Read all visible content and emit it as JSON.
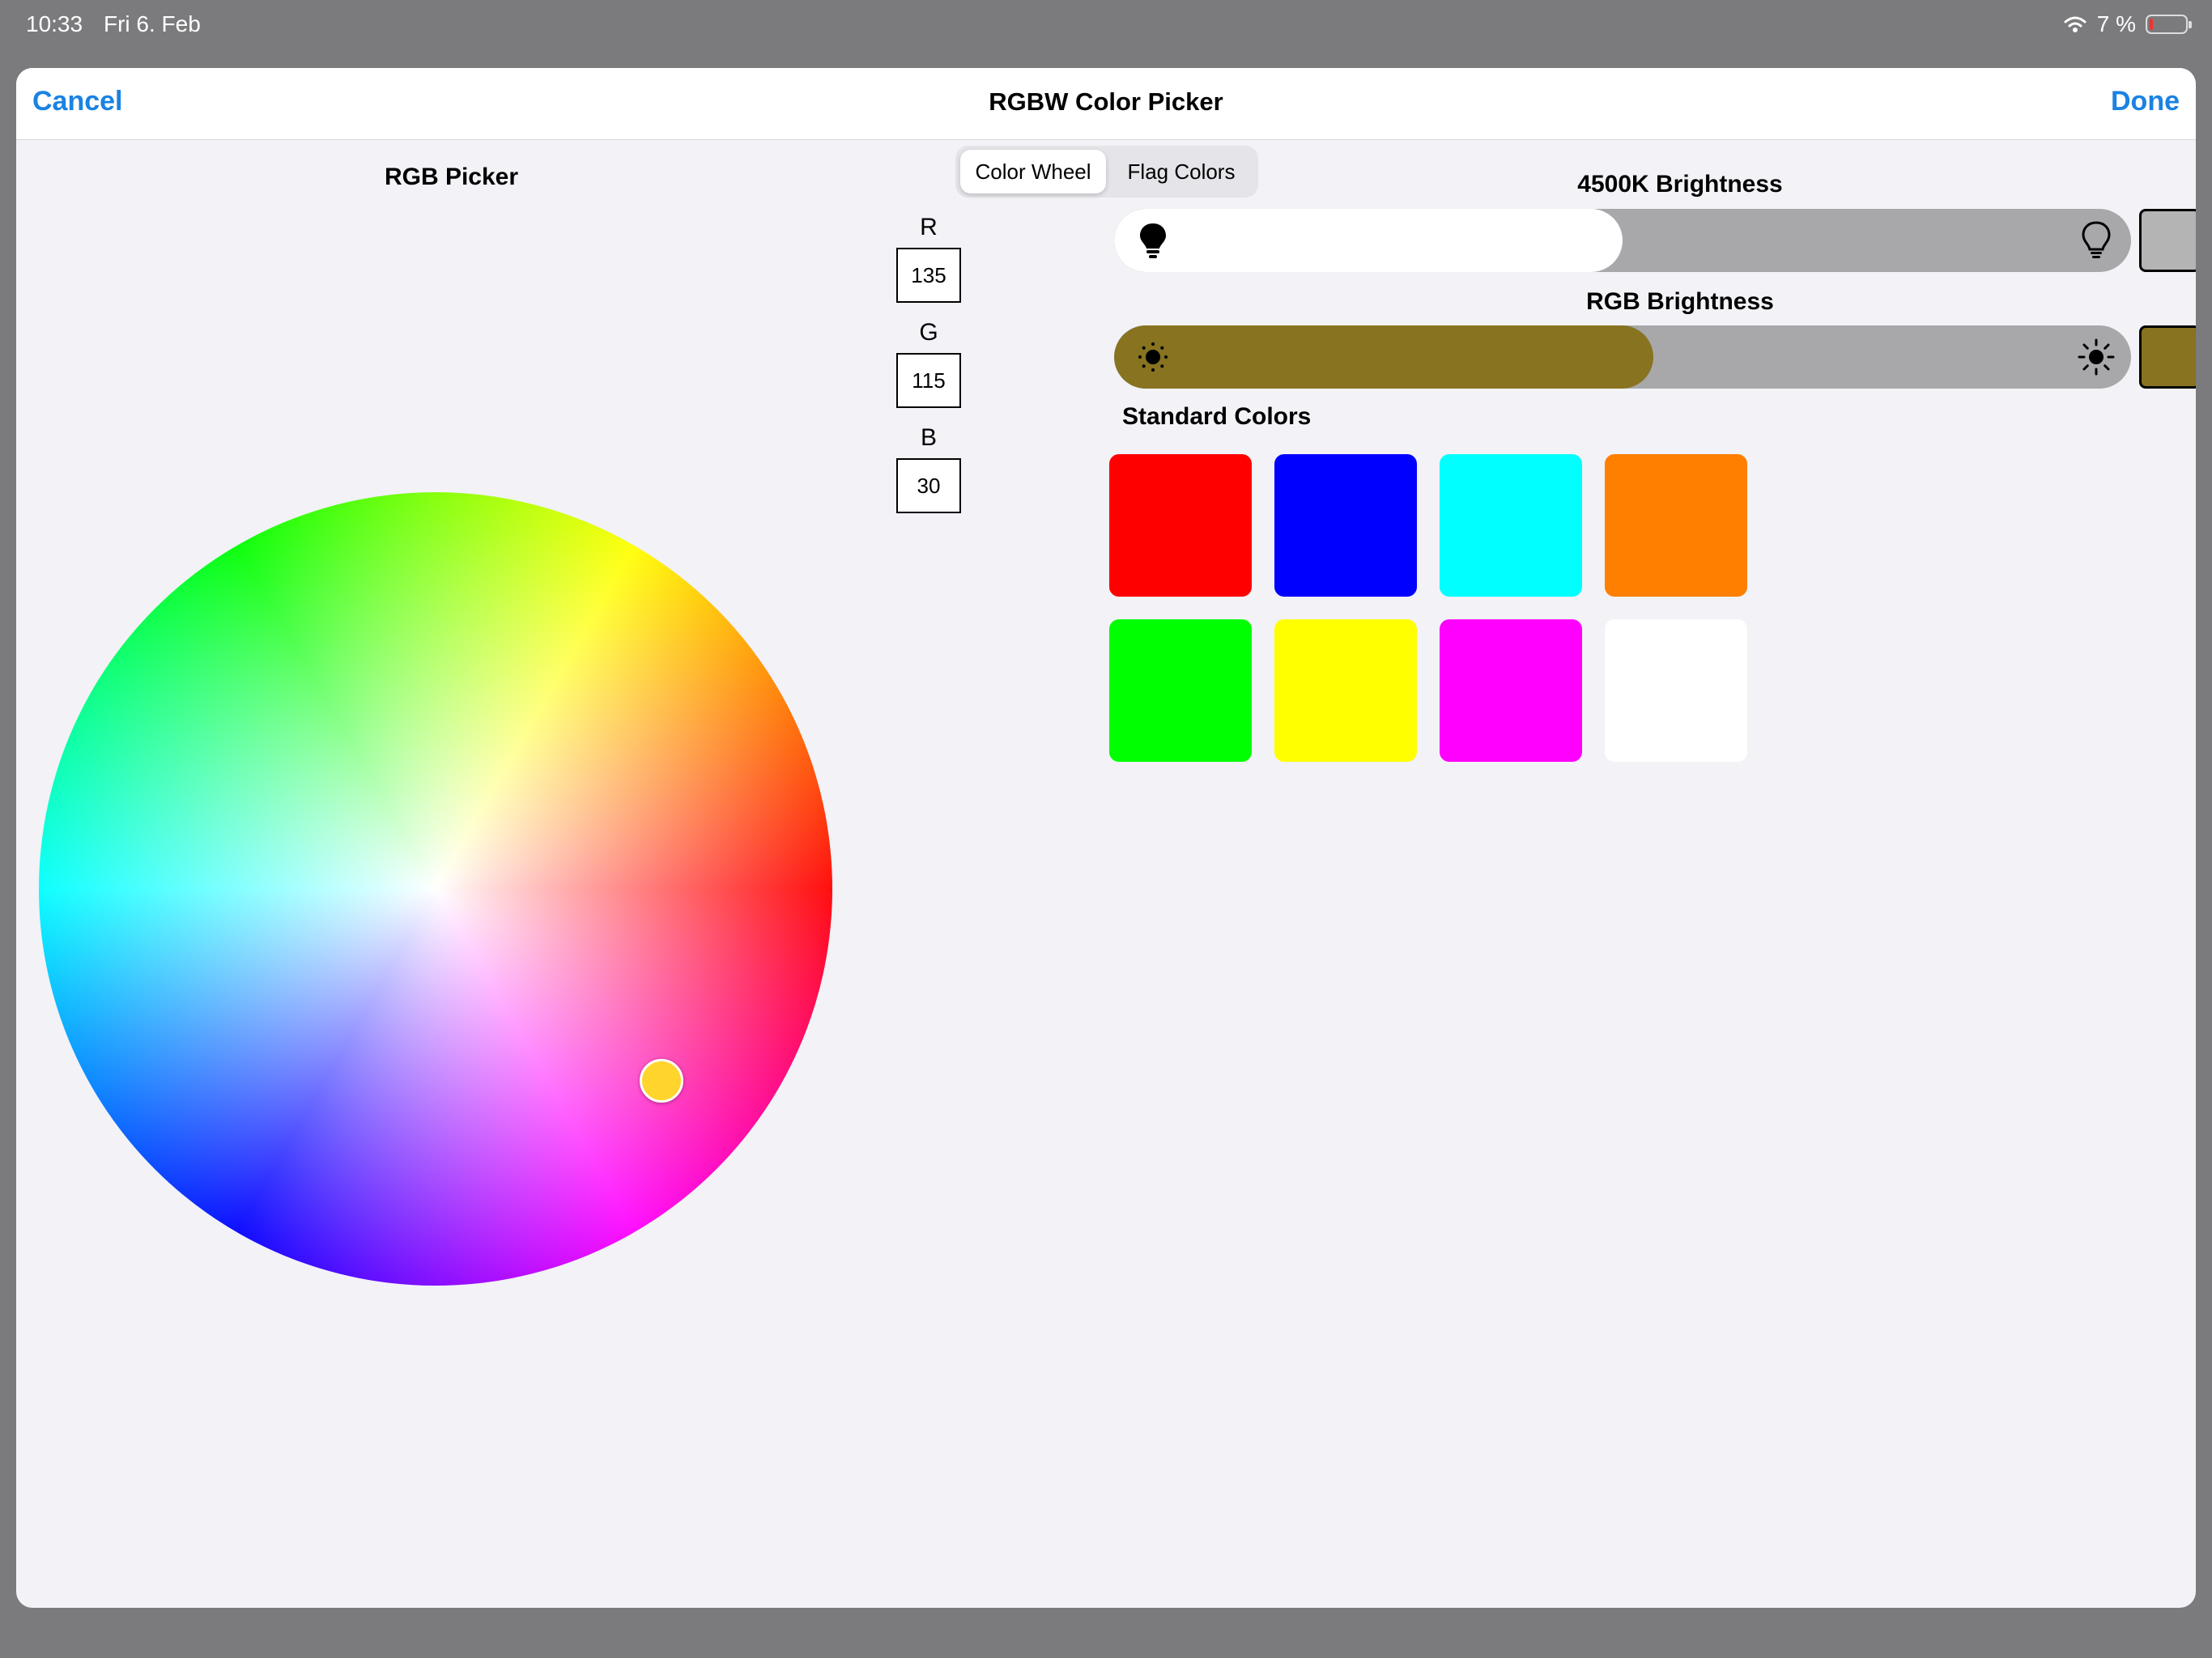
{
  "status_bar": {
    "time": "10:33",
    "date": "Fri 6. Feb",
    "battery": "7 %"
  },
  "navbar": {
    "cancel": "Cancel",
    "title": "RGBW Color Picker",
    "done": "Done"
  },
  "rgb_picker": {
    "title": "RGB Picker",
    "handle_color": "#ffd52d"
  },
  "mode_tabs": {
    "selected": "Color Wheel",
    "items": [
      "Color Wheel",
      "Flag Colors"
    ]
  },
  "channels": {
    "r_label": "R",
    "r_value": "135",
    "g_label": "G",
    "g_value": "115",
    "b_label": "B",
    "b_value": "30"
  },
  "white_brightness": {
    "title": "4500K Brightness",
    "level": 0.5,
    "fill_color": "#ffffff",
    "preview_color": "#b4b4b4"
  },
  "rgb_brightness": {
    "title": "RGB Brightness",
    "level": 0.53,
    "fill_color": "#877320",
    "preview_color": "#877320"
  },
  "standard_colors": {
    "title": "Standard Colors",
    "items": [
      {
        "name": "red",
        "color": "#ff0000"
      },
      {
        "name": "blue",
        "color": "#0000ff"
      },
      {
        "name": "cyan",
        "color": "#00ffff"
      },
      {
        "name": "orange",
        "color": "#ff7f00"
      },
      {
        "name": "green",
        "color": "#00ff00"
      },
      {
        "name": "yellow",
        "color": "#ffff00"
      },
      {
        "name": "magenta",
        "color": "#ff00ff"
      },
      {
        "name": "white",
        "color": "#ffffff"
      }
    ]
  }
}
